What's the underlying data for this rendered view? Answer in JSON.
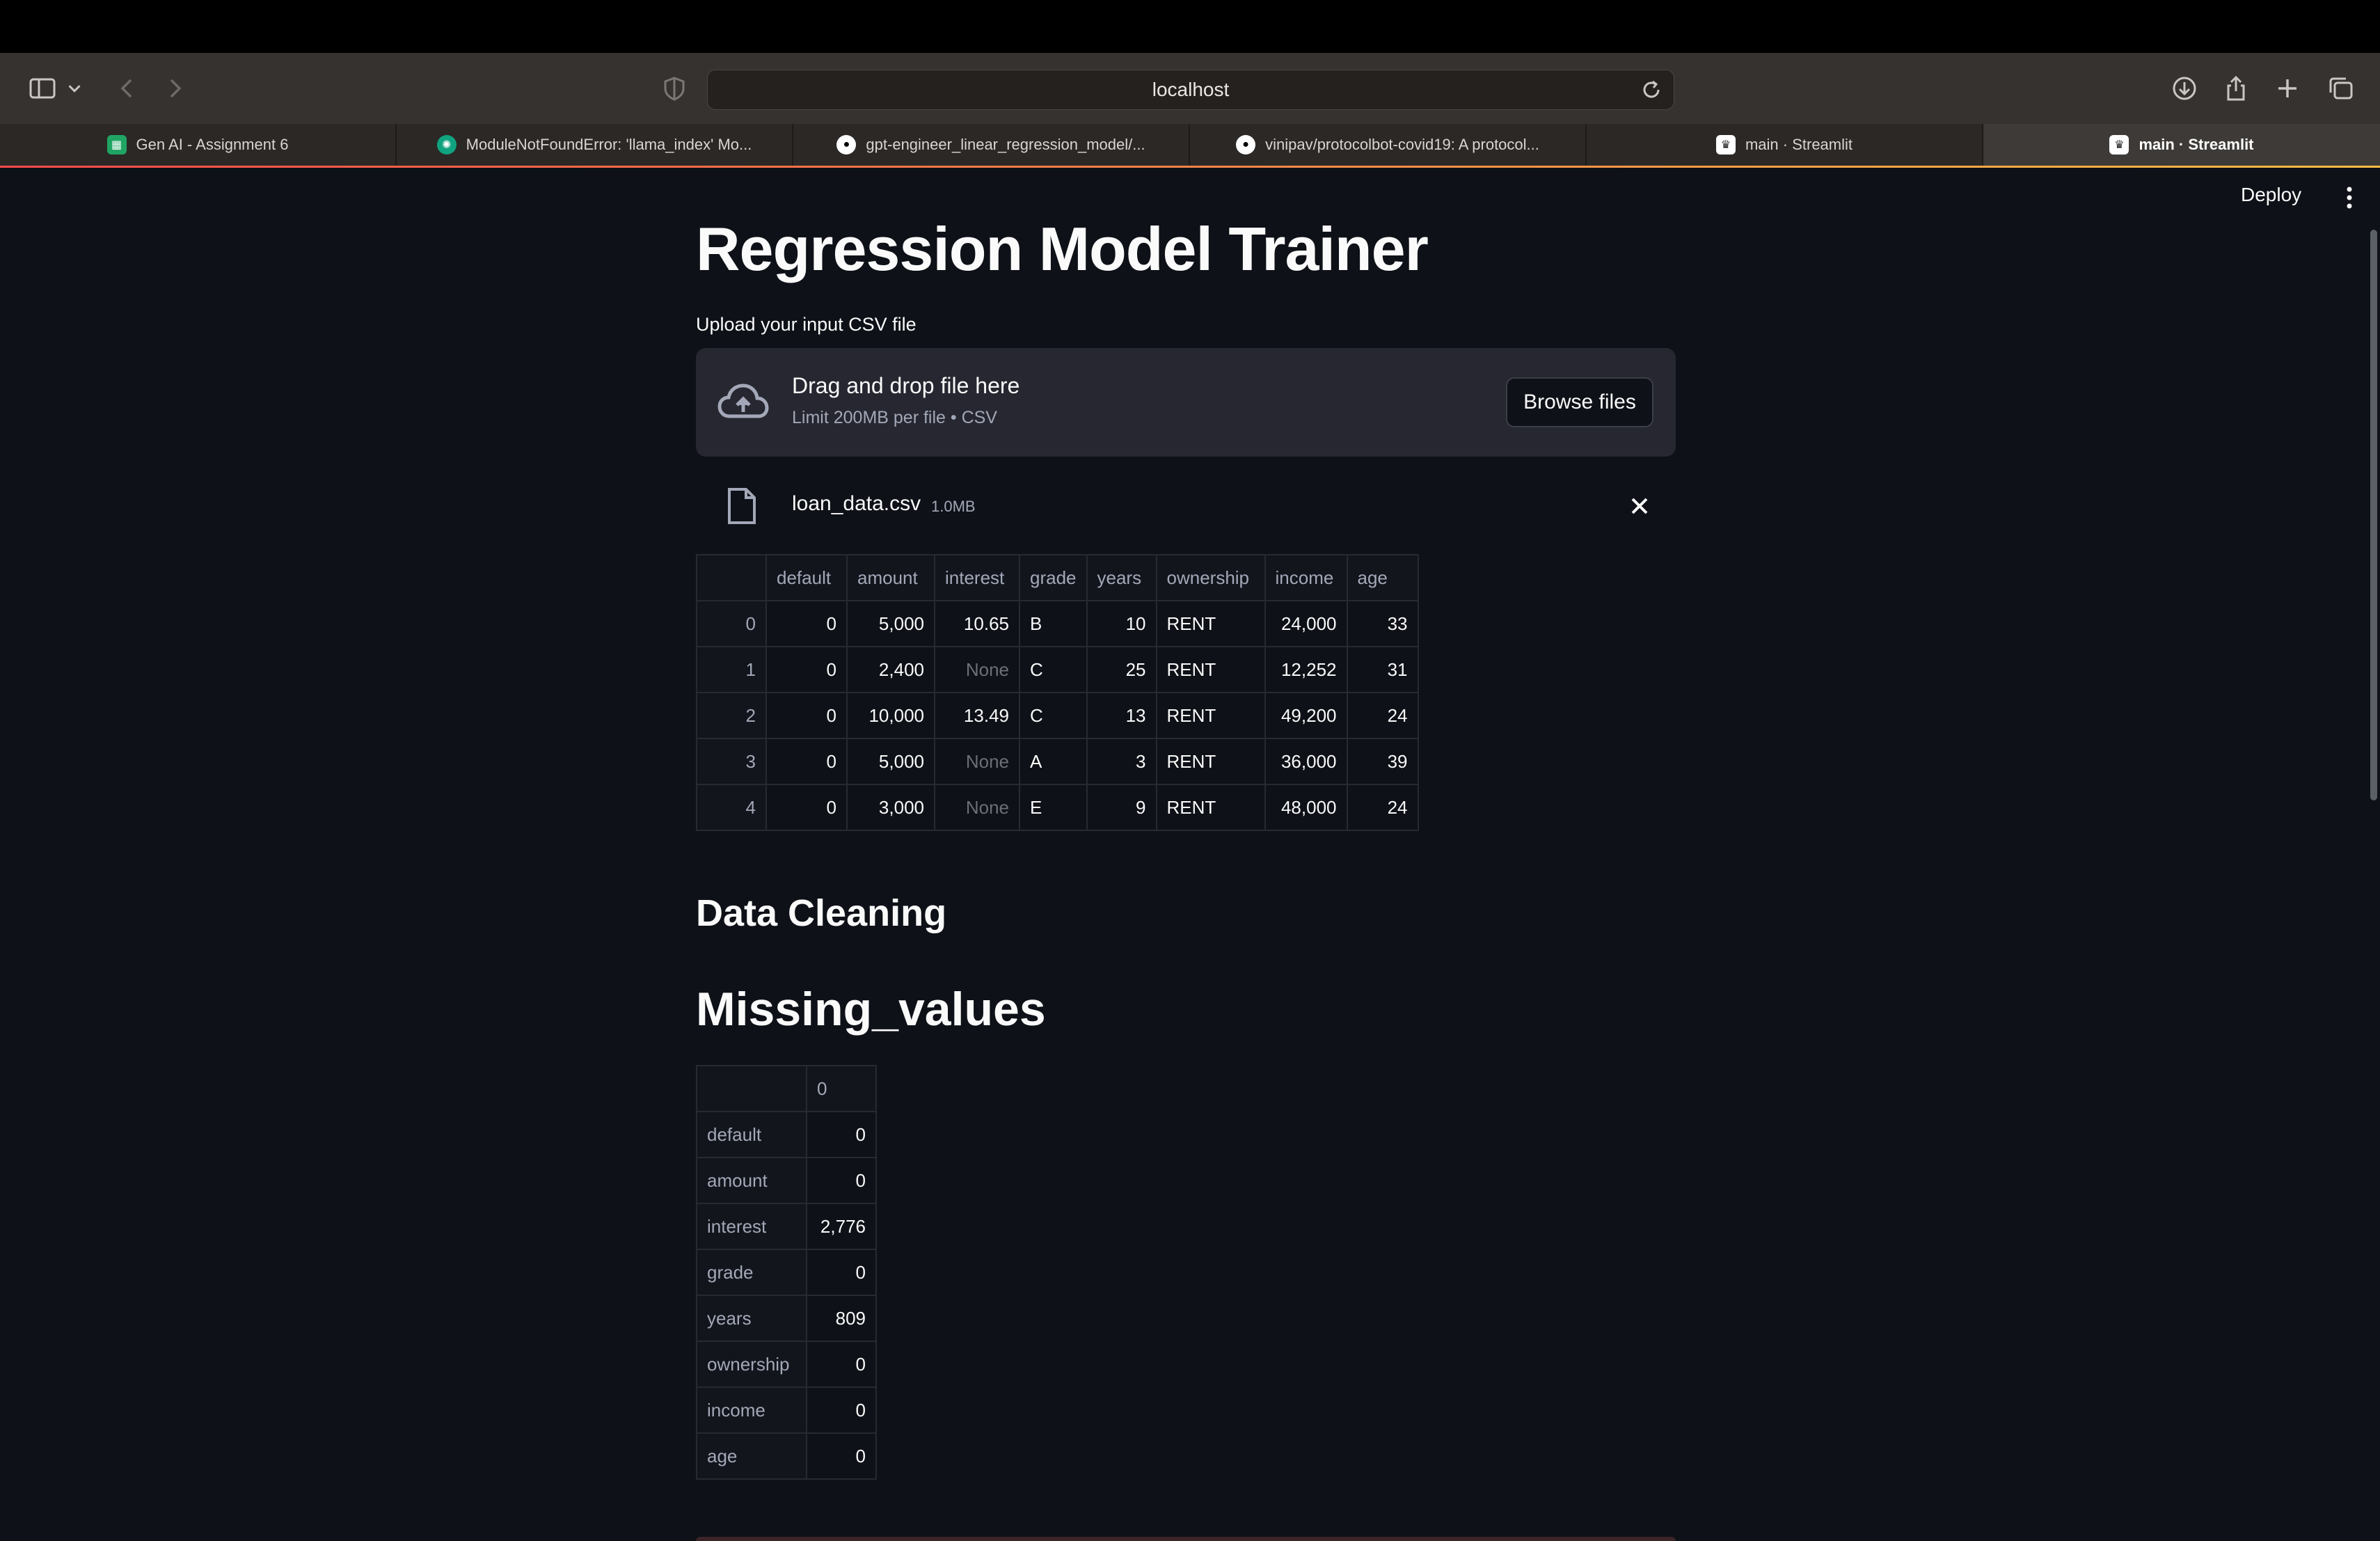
{
  "browser": {
    "url": "localhost",
    "tabs": [
      {
        "label": "Gen AI - Assignment 6",
        "favicon": "sheets-icon",
        "active": false
      },
      {
        "label": "ModuleNotFoundError: 'llama_index' Mo...",
        "favicon": "chatgpt-icon",
        "active": false
      },
      {
        "label": "gpt-engineer_linear_regression_model/...",
        "favicon": "github-icon",
        "active": false
      },
      {
        "label": "vinipav/protocolbot-covid19: A protocol...",
        "favicon": "github-icon",
        "active": false
      },
      {
        "label": "main · Streamlit",
        "favicon": "streamlit-icon",
        "active": false
      },
      {
        "label": "main · Streamlit",
        "favicon": "streamlit-icon",
        "active": true
      }
    ]
  },
  "app": {
    "deploy_label": "Deploy",
    "title": "Regression Model Trainer",
    "uploader": {
      "label": "Upload your input CSV file",
      "drop_text": "Drag and drop file here",
      "limit_text": "Limit 200MB per file • CSV",
      "browse_label": "Browse files"
    },
    "file": {
      "name": "loan_data.csv",
      "size": "1.0MB"
    },
    "preview_table": {
      "columns": [
        "",
        "default",
        "amount",
        "interest",
        "grade",
        "years",
        "ownership",
        "income",
        "age"
      ],
      "rows": [
        [
          "0",
          "0",
          "5,000",
          "10.65",
          "B",
          "10",
          "RENT",
          "24,000",
          "33"
        ],
        [
          "1",
          "0",
          "2,400",
          "None",
          "C",
          "25",
          "RENT",
          "12,252",
          "31"
        ],
        [
          "2",
          "0",
          "10,000",
          "13.49",
          "C",
          "13",
          "RENT",
          "49,200",
          "24"
        ],
        [
          "3",
          "0",
          "5,000",
          "None",
          "A",
          "3",
          "RENT",
          "36,000",
          "39"
        ],
        [
          "4",
          "0",
          "3,000",
          "None",
          "E",
          "9",
          "RENT",
          "48,000",
          "24"
        ]
      ]
    },
    "section_cleaning": "Data Cleaning",
    "section_missing": "Missing_values",
    "missing_table": {
      "columns": [
        "",
        "0"
      ],
      "rows": [
        [
          "default",
          "0"
        ],
        [
          "amount",
          "0"
        ],
        [
          "interest",
          "2,776"
        ],
        [
          "grade",
          "0"
        ],
        [
          "years",
          "809"
        ],
        [
          "ownership",
          "0"
        ],
        [
          "income",
          "0"
        ],
        [
          "age",
          "0"
        ]
      ]
    }
  }
}
